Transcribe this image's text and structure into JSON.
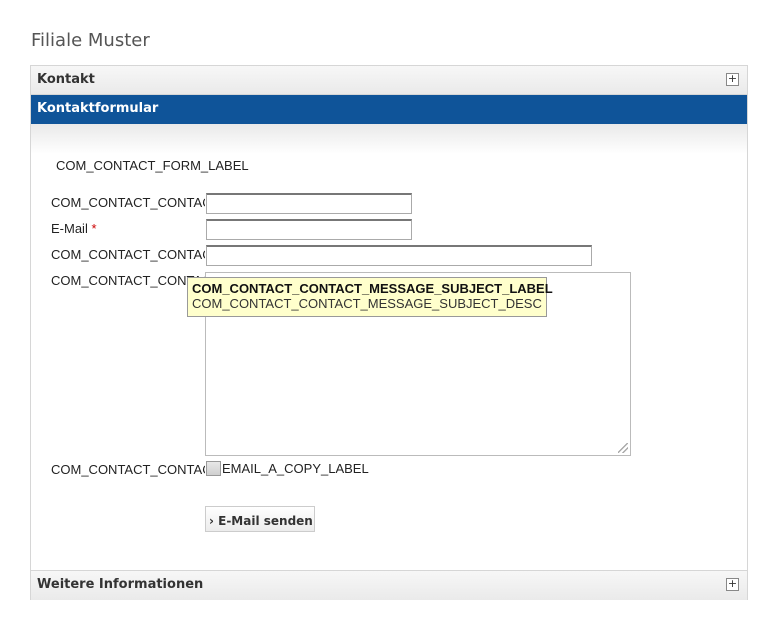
{
  "page": {
    "title": "Filiale Muster"
  },
  "accordion": {
    "kontakt": {
      "label": "Kontakt",
      "toggle": "+"
    },
    "kontaktformular": {
      "label": "Kontaktformular"
    },
    "weitere": {
      "label": "Weitere Informationen",
      "toggle": "+"
    }
  },
  "form": {
    "legend": "COM_CONTACT_FORM_LABEL",
    "name_label": "COM_CONTACT_CONTACT_EMAIL_NAME_LABEL",
    "name_value": "",
    "email_label": "E-Mail",
    "email_required": "*",
    "email_value": "",
    "subject_label": "COM_CONTACT_CONTACT_MESSAGE_SUBJECT_LABEL",
    "subject_value": "",
    "message_label": "COM_CONTACT_CONTACT_ENTER_MESSAGE_LABEL",
    "copy_label": "COM_CONTACT_CONTACT_EMAIL_A_COPY_LABEL",
    "copy_checkbox_text": "EMAIL_A_COPY_LABEL",
    "submit_label": "› E-Mail senden"
  },
  "tooltip": {
    "title": "COM_CONTACT_CONTACT_MESSAGE_SUBJECT_LABEL",
    "desc": "COM_CONTACT_CONTACT_MESSAGE_SUBJECT_DESC"
  }
}
